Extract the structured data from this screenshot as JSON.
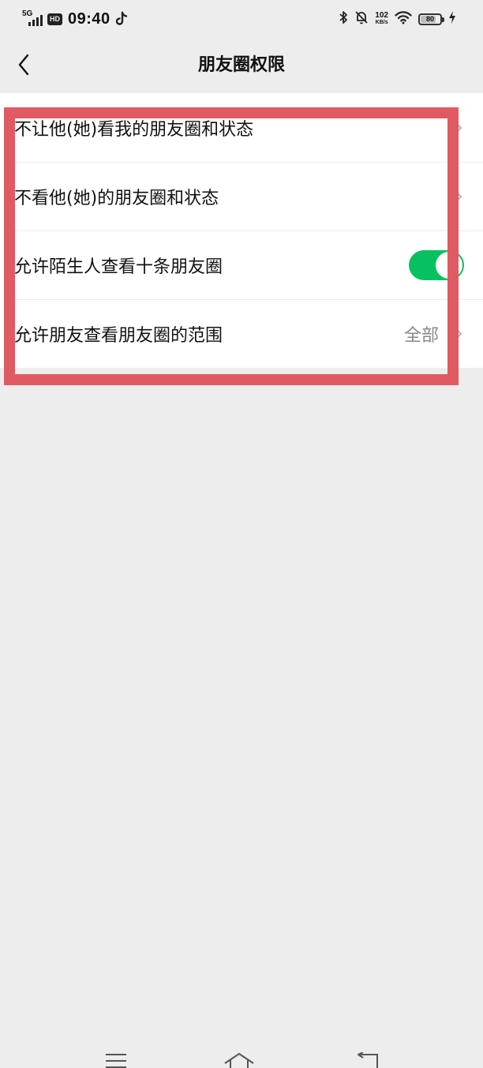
{
  "status_bar": {
    "network": "5G",
    "hd": "HD",
    "time": "09:40",
    "speed_value": "102",
    "speed_unit": "KB/s",
    "battery": "80",
    "battery_level": 0.8
  },
  "nav": {
    "title": "朋友圈权限"
  },
  "settings": {
    "items": [
      {
        "label": "不让他(她)看我的朋友圈和状态"
      },
      {
        "label": "不看他(她)的朋友圈和状态"
      },
      {
        "label": "允许陌生人查看十条朋友圈",
        "toggle_on": true
      },
      {
        "label": "允许朋友查看朋友圈的范围",
        "value": "全部"
      }
    ]
  },
  "colors": {
    "toggle_on": "#07c160",
    "highlight": "#e05a62",
    "background": "#ededed"
  },
  "icons": {
    "back": "chevron-left-icon",
    "row_arrow": "chevron-right-icon",
    "bottom_nav": [
      "menu-icon",
      "home-icon",
      "back-icon"
    ]
  }
}
